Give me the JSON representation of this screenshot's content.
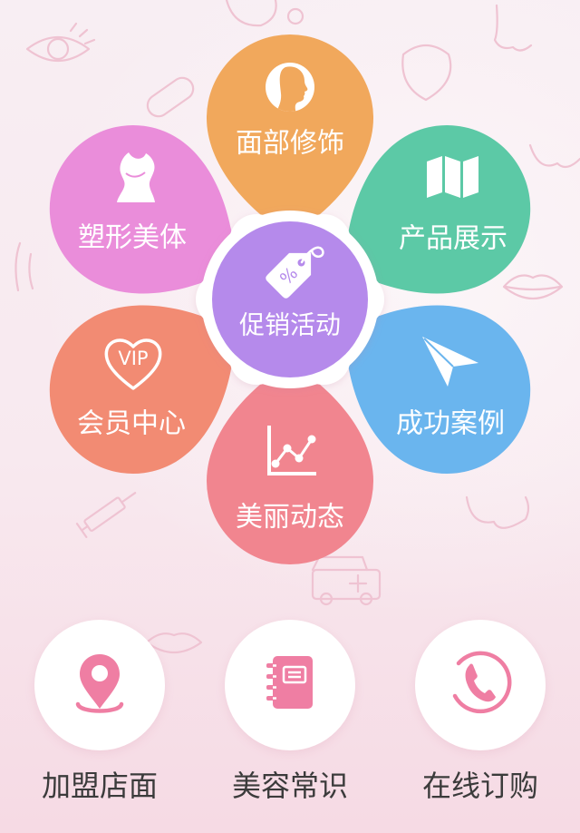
{
  "theme": {
    "icon_pink": "#EF7EA3"
  },
  "flower": {
    "center": {
      "label": "促销活动",
      "icon": "discount-tag-icon",
      "symbol": "%",
      "color": "#B58AEB"
    },
    "petals": [
      {
        "label": "面部修饰",
        "icon": "face-profile-icon",
        "color": "#F1A85C"
      },
      {
        "label": "产品展示",
        "icon": "folded-map-icon",
        "color": "#5CC9A6"
      },
      {
        "label": "成功案例",
        "icon": "paper-plane-icon",
        "color": "#6AB5EE"
      },
      {
        "label": "美丽动态",
        "icon": "line-chart-icon",
        "color": "#F1858F"
      },
      {
        "label": "会员中心",
        "icon": "vip-heart-icon",
        "badge": "VIP",
        "color": "#F28B73"
      },
      {
        "label": "塑形美体",
        "icon": "body-torso-icon",
        "color": "#EA8DDA"
      }
    ]
  },
  "shortcuts": [
    {
      "label": "加盟店面",
      "icon": "location-pin-icon"
    },
    {
      "label": "美容常识",
      "icon": "notebook-icon"
    },
    {
      "label": "在线订购",
      "icon": "phone-icon"
    }
  ]
}
